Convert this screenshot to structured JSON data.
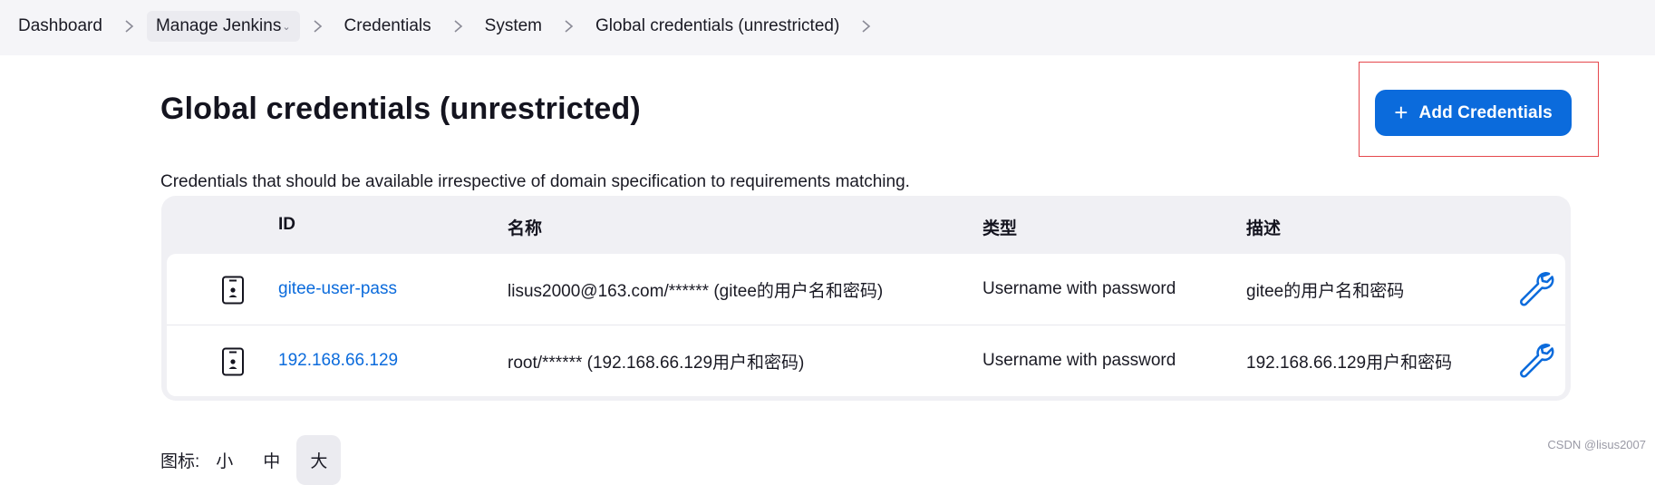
{
  "breadcrumb": [
    {
      "label": "Dashboard",
      "has_caret": false
    },
    {
      "label": "Manage Jenkins",
      "has_caret": true
    },
    {
      "label": "Credentials",
      "has_caret": false
    },
    {
      "label": "System",
      "has_caret": false
    },
    {
      "label": "Global credentials (unrestricted)",
      "has_caret": false
    }
  ],
  "page": {
    "title": "Global credentials (unrestricted)",
    "description": "Credentials that should be available irrespective of domain specification to requirements matching.",
    "add_button_label": "Add Credentials",
    "add_button_icon": "plus-icon"
  },
  "table": {
    "headers": {
      "id": "ID",
      "name": "名称",
      "type": "类型",
      "desc": "描述"
    },
    "rows": [
      {
        "icon": "credential-phone-icon",
        "id": "gitee-user-pass",
        "name": "lisus2000@163.com/****** (gitee的用户名和密码)",
        "type": "Username with password",
        "desc": "gitee的用户名和密码",
        "action_icon": "wrench-icon"
      },
      {
        "icon": "credential-phone-icon",
        "id": "192.168.66.129",
        "name": "root/****** (192.168.66.129用户和密码)",
        "type": "Username with password",
        "desc": "192.168.66.129用户和密码",
        "action_icon": "wrench-icon"
      }
    ]
  },
  "icon_size": {
    "label": "图标:",
    "options": [
      "小",
      "中",
      "大"
    ],
    "selected": "大"
  },
  "watermark": "CSDN @lisus2007",
  "colors": {
    "accent": "#0b6bdc",
    "highlight_border": "#e5484d",
    "topbar_bg": "#f5f5f8",
    "table_bg": "#f0f0f4"
  }
}
